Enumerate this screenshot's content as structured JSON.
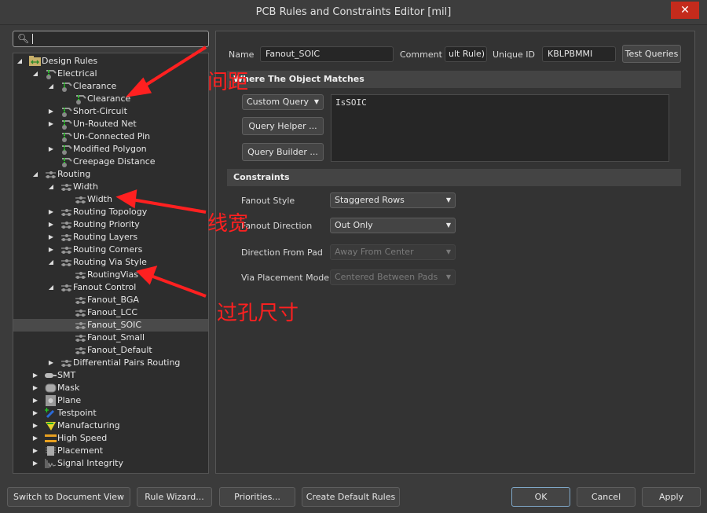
{
  "window": {
    "title": "PCB Rules and Constraints Editor [mil]",
    "close": "✕"
  },
  "search": {
    "value": ""
  },
  "tree": [
    {
      "label": "Design Rules",
      "level": 0,
      "exp": "open",
      "icon": "folder"
    },
    {
      "label": "Electrical",
      "level": 1,
      "exp": "open",
      "icon": "electrical"
    },
    {
      "label": "Clearance",
      "level": 2,
      "exp": "open",
      "icon": "electrical"
    },
    {
      "label": "Clearance",
      "level": 3,
      "exp": "",
      "icon": "electrical"
    },
    {
      "label": "Short-Circuit",
      "level": 2,
      "exp": "closed",
      "icon": "electrical"
    },
    {
      "label": "Un-Routed Net",
      "level": 2,
      "exp": "closed",
      "icon": "electrical"
    },
    {
      "label": "Un-Connected Pin",
      "level": 2,
      "exp": "",
      "icon": "electrical"
    },
    {
      "label": "Modified Polygon",
      "level": 2,
      "exp": "closed",
      "icon": "electrical"
    },
    {
      "label": "Creepage Distance",
      "level": 2,
      "exp": "",
      "icon": "electrical"
    },
    {
      "label": "Routing",
      "level": 1,
      "exp": "open",
      "icon": "routing"
    },
    {
      "label": "Width",
      "level": 2,
      "exp": "open",
      "icon": "routing"
    },
    {
      "label": "Width",
      "level": 3,
      "exp": "",
      "icon": "routing"
    },
    {
      "label": "Routing Topology",
      "level": 2,
      "exp": "closed",
      "icon": "routing"
    },
    {
      "label": "Routing Priority",
      "level": 2,
      "exp": "closed",
      "icon": "routing"
    },
    {
      "label": "Routing Layers",
      "level": 2,
      "exp": "closed",
      "icon": "routing"
    },
    {
      "label": "Routing Corners",
      "level": 2,
      "exp": "closed",
      "icon": "routing"
    },
    {
      "label": "Routing Via Style",
      "level": 2,
      "exp": "open",
      "icon": "routing"
    },
    {
      "label": "RoutingVias",
      "level": 3,
      "exp": "",
      "icon": "routing"
    },
    {
      "label": "Fanout Control",
      "level": 2,
      "exp": "open",
      "icon": "routing"
    },
    {
      "label": "Fanout_BGA",
      "level": 3,
      "exp": "",
      "icon": "routing"
    },
    {
      "label": "Fanout_LCC",
      "level": 3,
      "exp": "",
      "icon": "routing"
    },
    {
      "label": "Fanout_SOIC",
      "level": 3,
      "exp": "",
      "icon": "routing",
      "selected": true
    },
    {
      "label": "Fanout_Small",
      "level": 3,
      "exp": "",
      "icon": "routing"
    },
    {
      "label": "Fanout_Default",
      "level": 3,
      "exp": "",
      "icon": "routing"
    },
    {
      "label": "Differential Pairs Routing",
      "level": 2,
      "exp": "closed",
      "icon": "routing"
    },
    {
      "label": "SMT",
      "level": 1,
      "exp": "closed",
      "icon": "smt"
    },
    {
      "label": "Mask",
      "level": 1,
      "exp": "closed",
      "icon": "mask"
    },
    {
      "label": "Plane",
      "level": 1,
      "exp": "closed",
      "icon": "plane"
    },
    {
      "label": "Testpoint",
      "level": 1,
      "exp": "closed",
      "icon": "testpoint"
    },
    {
      "label": "Manufacturing",
      "level": 1,
      "exp": "closed",
      "icon": "manufacturing"
    },
    {
      "label": "High Speed",
      "level": 1,
      "exp": "closed",
      "icon": "highspeed"
    },
    {
      "label": "Placement",
      "level": 1,
      "exp": "closed",
      "icon": "placement"
    },
    {
      "label": "Signal Integrity",
      "level": 1,
      "exp": "closed",
      "icon": "signal"
    }
  ],
  "rule": {
    "name_label": "Name",
    "name": "Fanout_SOIC",
    "comment_label": "Comment",
    "comment": "ult Rule)",
    "uid_label": "Unique ID",
    "uid": "KBLPBMMI",
    "test_queries": "Test Queries",
    "where_title": "Where The Object Matches",
    "query_type": "Custom Query",
    "query_helper": "Query Helper ...",
    "query_builder": "Query Builder ...",
    "query": "IsSOIC",
    "constraints_title": "Constraints",
    "fanout_style_label": "Fanout Style",
    "fanout_style": "Staggered Rows",
    "fanout_direction_label": "Fanout Direction",
    "fanout_direction": "Out Only",
    "direction_from_pad_label": "Direction From Pad",
    "direction_from_pad": "Away From Center",
    "via_placement_label": "Via Placement Mode",
    "via_placement": "Centered Between Pads"
  },
  "buttons": {
    "switch": "Switch to Document View",
    "wizard": "Rule Wizard...",
    "priorities": "Priorities...",
    "create_default": "Create Default Rules",
    "ok": "OK",
    "cancel": "Cancel",
    "apply": "Apply"
  },
  "annotations": {
    "clearance": "间距",
    "width": "线宽",
    "via": "过孔尺寸",
    "color": "#ff2020"
  }
}
